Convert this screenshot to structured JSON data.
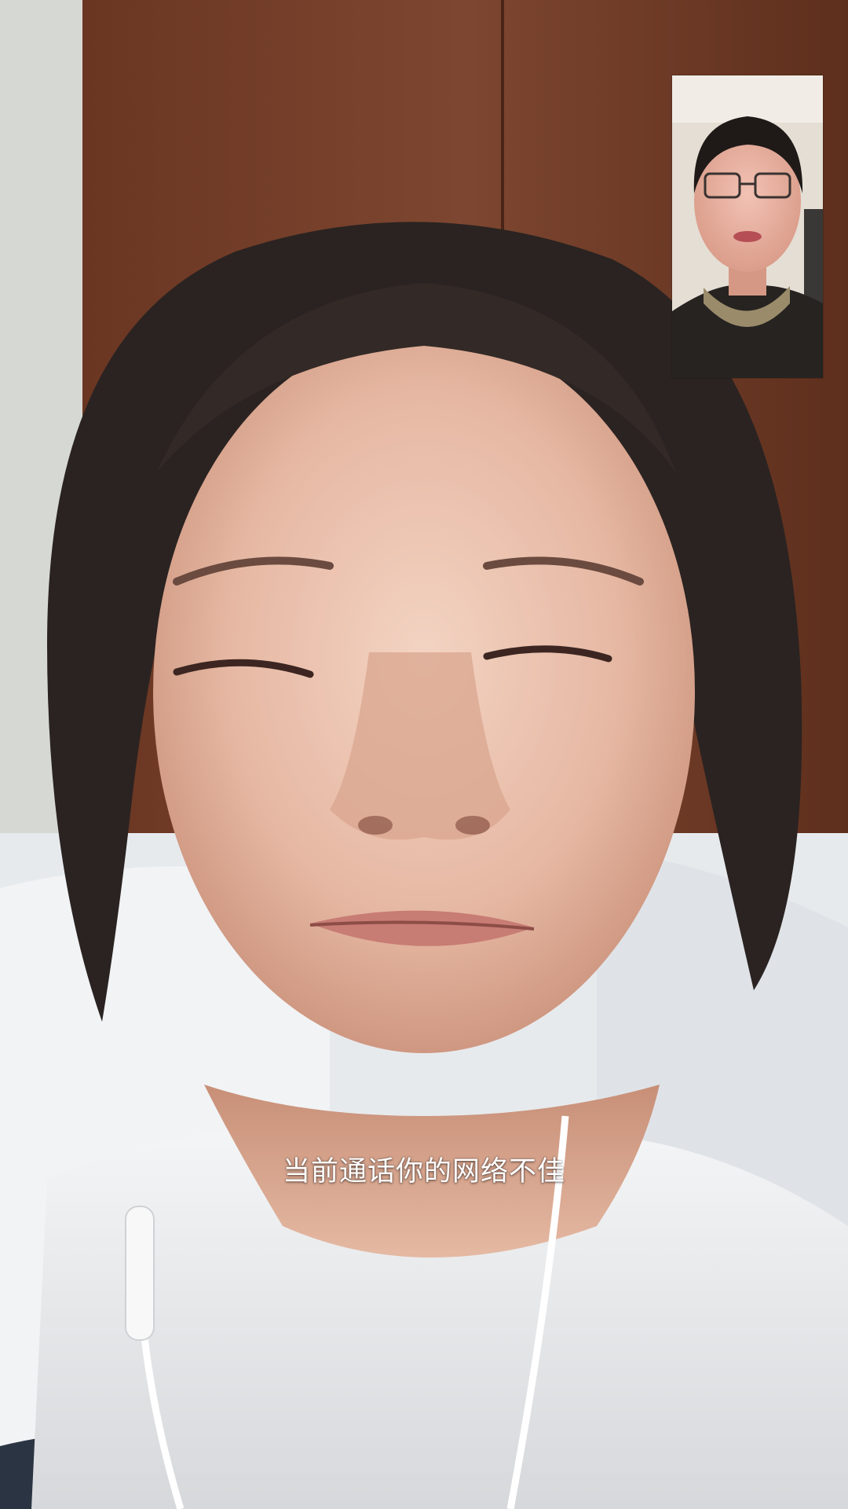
{
  "call": {
    "remote_video": {
      "description_icon": "remote-video-feed",
      "wall_color": "#7a4128",
      "bedding_color": "#e9ecef"
    },
    "local_preview": {
      "description_icon": "local-camera-preview"
    },
    "toast": {
      "message": "当前通话你的网络不佳"
    }
  }
}
